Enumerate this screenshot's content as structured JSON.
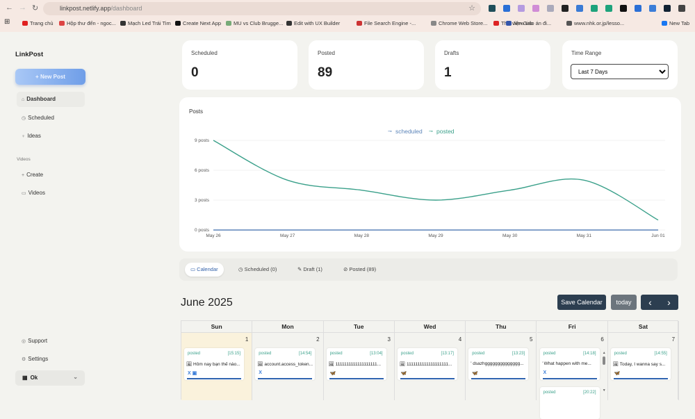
{
  "browser": {
    "url_host": "linkpost.netlify.app",
    "url_path": "/dashboard",
    "bookmarks": [
      "Trang chủ",
      "Hộp thư đến - ngoc...",
      "Mạch Led Trái Tim",
      "Create Next App",
      "MU vs Club Brugge...",
      "Edit with UX Builder",
      "File Search Engine -...",
      "Chrome Web Store...",
      "Thư viện Giáo án đi...",
      "New tab",
      "www.nhk.or.jp/lesso...",
      "New Tab"
    ]
  },
  "sidebar": {
    "logo": "LinkPost",
    "new_post": "+ New Post",
    "items": [
      {
        "label": "Dashboard",
        "icon": "home"
      },
      {
        "label": "Scheduled",
        "icon": "clock"
      },
      {
        "label": "Ideas",
        "icon": "lightbulb"
      }
    ],
    "videos_section": "Videos",
    "video_items": [
      {
        "label": "Create",
        "icon": "plus"
      },
      {
        "label": "Videos",
        "icon": "video"
      }
    ],
    "bottom": [
      {
        "label": "Support",
        "icon": "support"
      },
      {
        "label": "Settings",
        "icon": "gear"
      }
    ],
    "workspace": "Ok"
  },
  "stats": [
    {
      "label": "Scheduled",
      "value": "0"
    },
    {
      "label": "Posted",
      "value": "89"
    },
    {
      "label": "Drafts",
      "value": "1"
    }
  ],
  "time_range": {
    "label": "Time Range",
    "selected": "Last 7 Days"
  },
  "chart_data": {
    "type": "line",
    "title": "Posts",
    "categories": [
      "May 26",
      "May 27",
      "May 28",
      "May 29",
      "May 30",
      "May 31",
      "Jun 01"
    ],
    "series": [
      {
        "name": "scheduled",
        "color": "#5b84b8",
        "values": [
          0,
          0,
          0,
          0,
          0,
          0,
          0
        ]
      },
      {
        "name": "posted",
        "color": "#3aa08a",
        "values": [
          9,
          5,
          4,
          3,
          4,
          5,
          1
        ]
      }
    ],
    "yticks": [
      "0 posts",
      "3 posts",
      "6 posts",
      "9 posts"
    ],
    "ylim": [
      0,
      9
    ],
    "legend": "top-center",
    "grid": true
  },
  "tabs": [
    {
      "label": "Calendar",
      "active": true
    },
    {
      "label": "Scheduled (0)"
    },
    {
      "label": "Draft (1)"
    },
    {
      "label": "Posted (89)"
    }
  ],
  "calendar": {
    "month": "June 2025",
    "save": "Save Calendar",
    "today": "today",
    "prev": "‹",
    "next": "›",
    "days": [
      "Sun",
      "Mon",
      "Tue",
      "Wed",
      "Thu",
      "Fri",
      "Sat"
    ],
    "cells": [
      {
        "date": "1",
        "events": [
          {
            "status": "posted",
            "time": "[15:15]",
            "text": "🖼 Hôm nay bạn thế nào...",
            "platforms": "X ▣"
          }
        ]
      },
      {
        "date": "2",
        "events": [
          {
            "status": "posted",
            "time": "[14:54]",
            "text": "🖼 account.access_token...",
            "platforms": "X"
          }
        ]
      },
      {
        "date": "3",
        "events": [
          {
            "status": "posted",
            "time": "[13:04]",
            "text": "🖼 1111111111111111111...",
            "platforms": "🦋"
          }
        ]
      },
      {
        "date": "4",
        "events": [
          {
            "status": "posted",
            "time": "[13:17]",
            "text": "🖼 1111111111111111111...",
            "platforms": "🦋"
          }
        ]
      },
      {
        "date": "5",
        "events": [
          {
            "status": "posted",
            "time": "[13:23]",
            "text": "' dsazhgggggggggggggg...",
            "platforms": "🦋"
          }
        ]
      },
      {
        "date": "6",
        "events": [
          {
            "status": "posted",
            "time": "[14:18]",
            "text": "' What happen with me...",
            "platforms": "X"
          },
          {
            "status": "posted",
            "time": "[20:22]",
            "text": "",
            "platforms": ""
          }
        ]
      },
      {
        "date": "7",
        "events": [
          {
            "status": "posted",
            "time": "[14:55]",
            "text": "🖼 Today, I wanna say s...",
            "platforms": "🦋"
          }
        ]
      }
    ]
  }
}
